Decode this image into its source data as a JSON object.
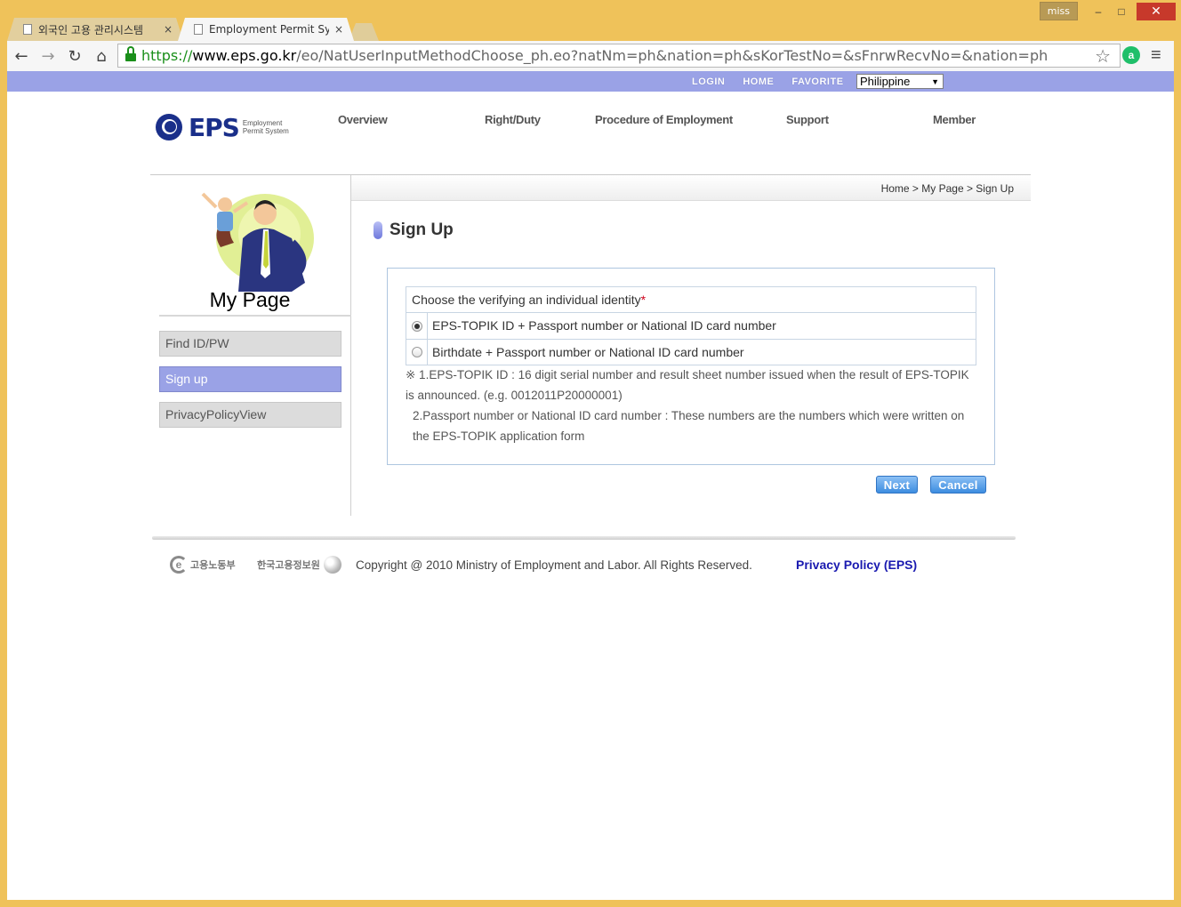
{
  "window": {
    "user_badge": "miss",
    "minimize": "‒",
    "maximize": "□",
    "close": "✕"
  },
  "tabs": [
    {
      "title": "외국인 고용 관리시스템",
      "close": "×"
    },
    {
      "title": "Employment Permit Syste",
      "close": "×"
    }
  ],
  "toolbar": {
    "back": "←",
    "forward": "→",
    "reload": "↻",
    "home": "⌂",
    "url_scheme": "https://",
    "url_host": "www.eps.go.kr",
    "url_rest": "/eo/NatUserInputMethodChoose_ph.eo?natNm=ph&nation=ph&sKorTestNo=&sFnrwRecvNo=&nation=ph",
    "star": "☆",
    "menu": "≡",
    "ext": "a"
  },
  "topbar": {
    "links": [
      "LOGIN",
      "HOME",
      "FAVORITE"
    ],
    "language": "Philippine"
  },
  "logo": {
    "text": "EPS",
    "sub1": "Employment",
    "sub2": "Permit System"
  },
  "gnb": [
    "Overview",
    "Right/Duty",
    "Procedure of Employment",
    "Support",
    "Member"
  ],
  "breadcrumb": "Home > My Page > Sign Up",
  "sidebar": {
    "title": "My Page",
    "items": [
      "Find ID/PW",
      "Sign up",
      "PrivacyPolicyView"
    ]
  },
  "main": {
    "title": "Sign Up",
    "question": "Choose the verifying an individual identity",
    "required_mark": "*",
    "options": [
      {
        "label": "EPS-TOPIK ID + Passport number or National ID card number",
        "checked": true
      },
      {
        "label": "Birthdate + Passport number or National ID card number",
        "checked": false
      }
    ],
    "note_line1": "※ 1.EPS-TOPIK ID : 16 digit serial number and result sheet number issued when the result of EPS-TOPIK is announced. (e.g. 0012011P20000001)",
    "note_line2": "2.Passport number or National ID card number : These numbers are the numbers which were written on the EPS-TOPIK application form",
    "next_label": "Next",
    "cancel_label": "Cancel"
  },
  "footer": {
    "logo1": "고용노동부",
    "logo2": "한국고용정보원",
    "copyright": "Copyright @ 2010 Ministry of Employment and Labor. All Rights Reserved.",
    "privacy": "Privacy Policy (EPS)"
  },
  "colors": {
    "accent": "#9aa2e6",
    "brand": "#1a2f8a",
    "button": "#3d8de0",
    "link": "#1a1ab0"
  }
}
